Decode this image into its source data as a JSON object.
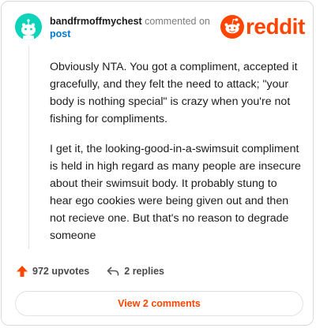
{
  "header": {
    "username": "bandfrmoffmychest",
    "action_text": "commented on",
    "post_link": "post"
  },
  "logo": {
    "text": "reddit",
    "color": "#ff4500"
  },
  "comment": {
    "paragraphs": [
      "Obviously NTA. You got a compliment, accepted it gracefully, and they felt the need to attack; \"your body is nothing special\" is crazy when you're not fishing for compliments.",
      "I get it, the looking-good-in-a-swimsuit compliment is held in high regard as many people are insecure about their swimsuit body. It probably stung to hear ego cookies were being given out and then not recieve one. But that's no reason to degrade someone"
    ]
  },
  "actions": {
    "upvotes": "972 upvotes",
    "replies": "2 replies"
  },
  "view_comments_label": "View 2 comments",
  "colors": {
    "accent": "#ff4500",
    "avatar": "#0dd3bb",
    "link": "#0079d3"
  },
  "icons": {
    "upvote": "upvote-arrow-icon",
    "reply": "reply-arrow-icon",
    "avatar": "snoo-avatar-icon"
  }
}
